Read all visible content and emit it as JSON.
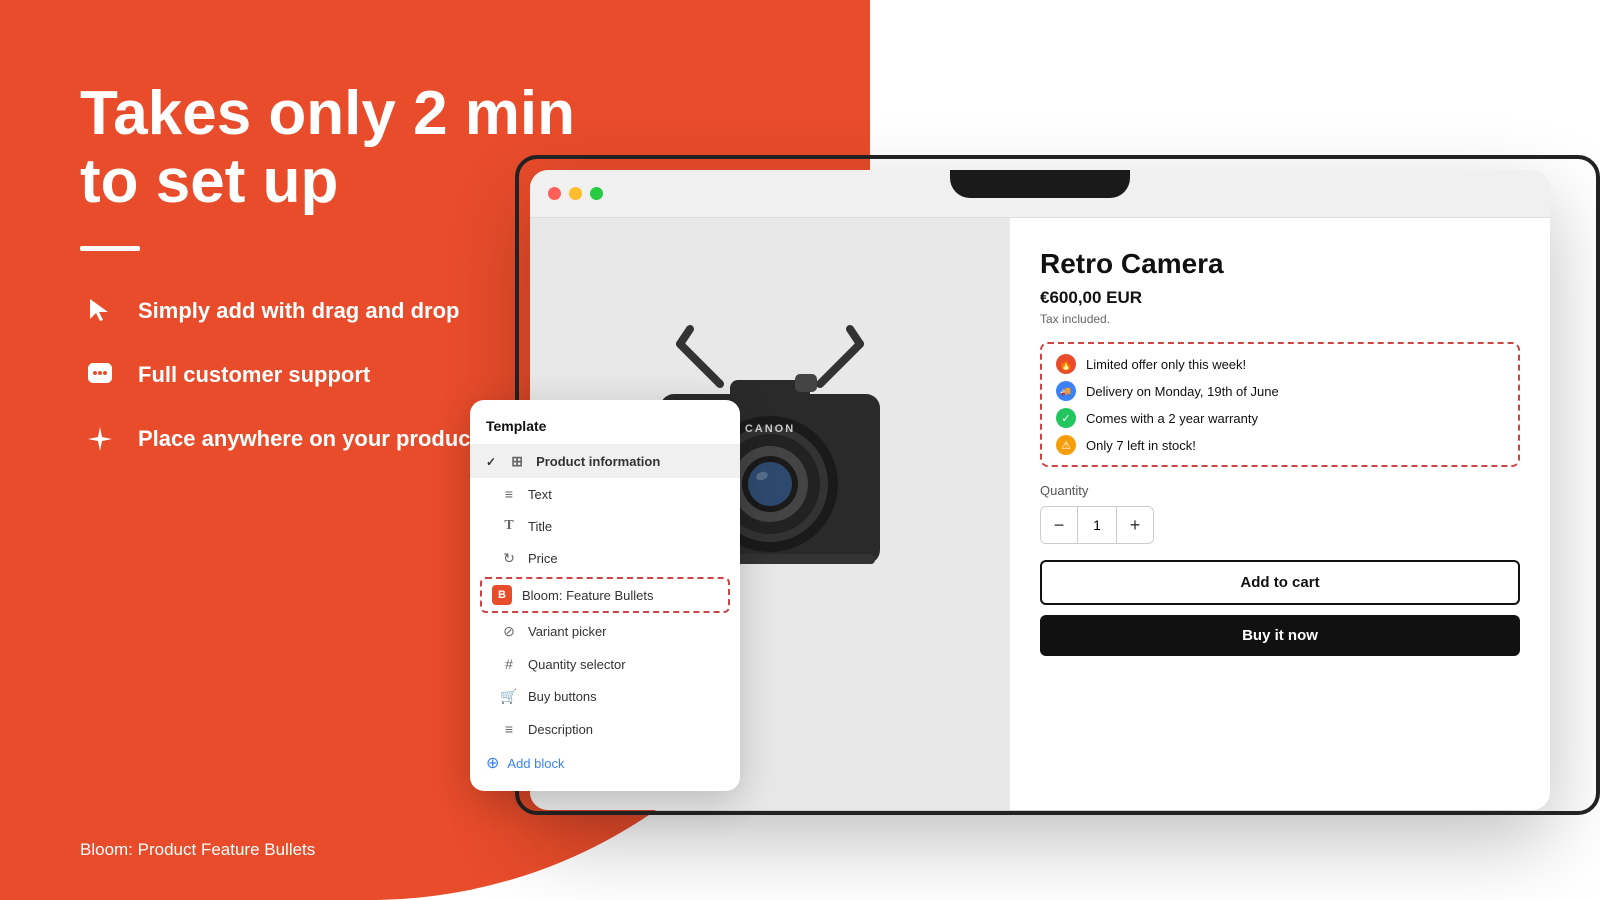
{
  "page": {
    "background_color": "#e84c2b"
  },
  "hero": {
    "title_line1": "Takes only 2 min",
    "title_line2": "to set up",
    "divider": true,
    "features": [
      {
        "id": "drag-drop",
        "icon": "cursor",
        "text": "Simply add with drag and drop"
      },
      {
        "id": "support",
        "icon": "chat",
        "text": "Full customer support"
      },
      {
        "id": "place",
        "icon": "sparkle",
        "text": "Place anywhere on your product page"
      }
    ],
    "brand_label": "Bloom: Product Feature Bullets"
  },
  "browser": {
    "dots": [
      "red",
      "yellow",
      "green"
    ],
    "product": {
      "name": "Retro Camera",
      "price": "€600,00 EUR",
      "tax_info": "Tax included.",
      "bullets": [
        {
          "id": "offer",
          "icon_type": "red",
          "icon_symbol": "🔥",
          "text": "Limited offer only this week!"
        },
        {
          "id": "delivery",
          "icon_type": "blue",
          "icon_symbol": "🚚",
          "text": "Delivery on Monday, 19th of June"
        },
        {
          "id": "warranty",
          "icon_type": "green",
          "icon_symbol": "✓",
          "text": "Comes with a 2 year warranty"
        },
        {
          "id": "stock",
          "icon_type": "yellow",
          "icon_symbol": "⚠",
          "text": "Only 7 left in stock!"
        }
      ],
      "quantity_label": "Quantity",
      "quantity_value": "1",
      "add_to_cart_label": "Add to cart",
      "buy_now_label": "Buy it now"
    }
  },
  "template_panel": {
    "header": "Template",
    "items": [
      {
        "id": "product-info",
        "icon": "grid",
        "label": "Product information",
        "type": "parent",
        "active": true
      },
      {
        "id": "text",
        "icon": "lines",
        "label": "Text",
        "type": "child"
      },
      {
        "id": "title",
        "icon": "T",
        "label": "Title",
        "type": "child"
      },
      {
        "id": "price",
        "icon": "reload",
        "label": "Price",
        "type": "child"
      },
      {
        "id": "bloom",
        "icon": "B",
        "label": "Bloom: Feature Bullets",
        "type": "child-bloom"
      },
      {
        "id": "variant",
        "icon": "circle-x",
        "label": "Variant picker",
        "type": "child"
      },
      {
        "id": "quantity",
        "icon": "hash",
        "label": "Quantity selector",
        "type": "child"
      },
      {
        "id": "buy-buttons",
        "icon": "cart",
        "label": "Buy buttons",
        "type": "child"
      },
      {
        "id": "description",
        "icon": "lines",
        "label": "Description",
        "type": "child"
      }
    ],
    "add_block_label": "Add block"
  }
}
